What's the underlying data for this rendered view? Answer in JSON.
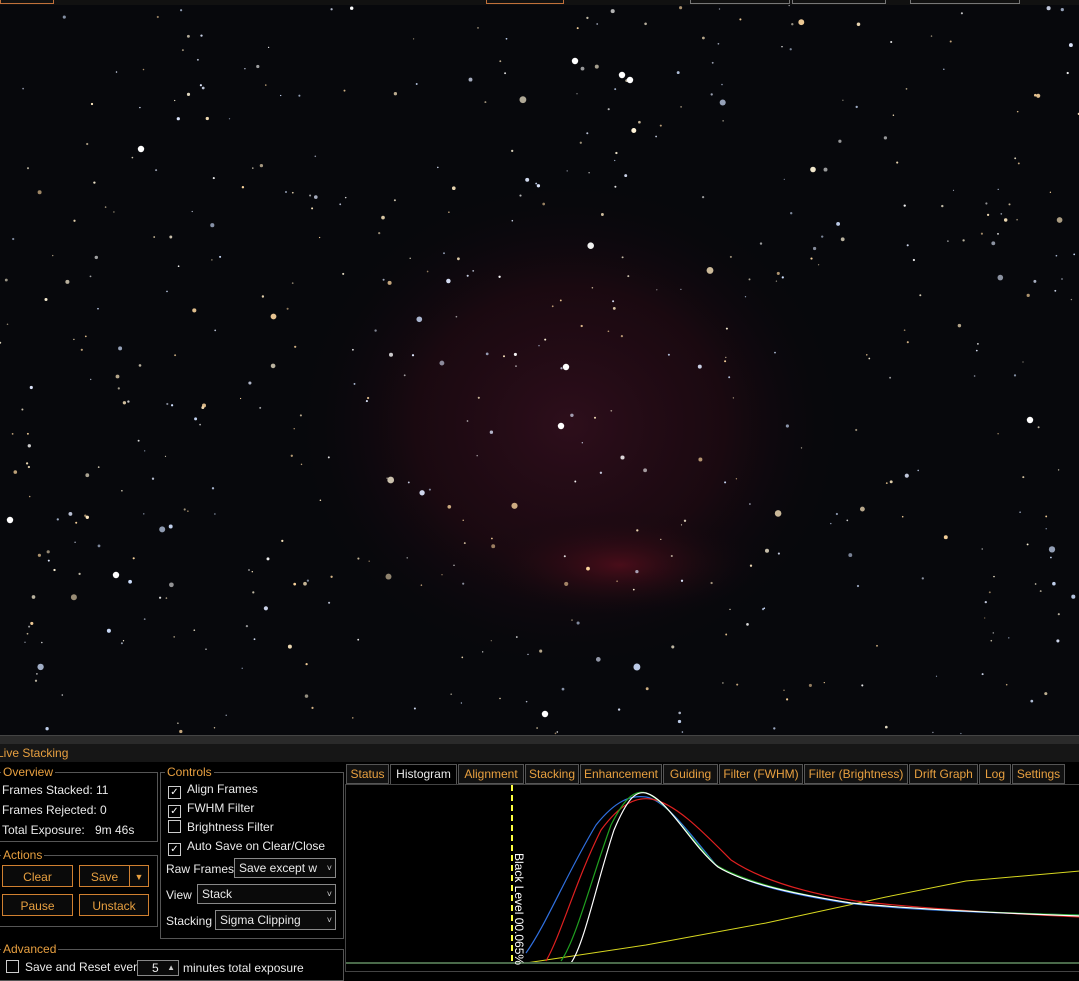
{
  "panel": {
    "title": "Live Stacking"
  },
  "overview": {
    "label": "Overview",
    "frames_stacked_label": "Frames Stacked:",
    "frames_stacked": "11",
    "frames_rejected_label": "Frames Rejected:",
    "frames_rejected": "0",
    "total_exposure_label": "Total Exposure:",
    "total_exposure": "9m 46s"
  },
  "actions": {
    "label": "Actions",
    "clear": "Clear",
    "save": "Save",
    "save_dropdown_icon": "chevron-down-icon",
    "pause": "Pause",
    "unstack": "Unstack"
  },
  "controls": {
    "label": "Controls",
    "align_frames": {
      "label": "Align Frames",
      "checked": true
    },
    "fwhm_filter": {
      "label": "FWHM Filter",
      "checked": true
    },
    "brightness_filter": {
      "label": "Brightness Filter",
      "checked": false
    },
    "auto_save": {
      "label": "Auto Save on Clear/Close",
      "checked": true
    },
    "raw_frames_label": "Raw Frames",
    "raw_frames_value": "Save except w",
    "view_label": "View",
    "view_value": "Stack",
    "stacking_label": "Stacking",
    "stacking_value": "Sigma Clipping"
  },
  "advanced": {
    "label": "Advanced",
    "save_reset_label": "Save and Reset every",
    "minutes_value": "5",
    "minutes_suffix": "minutes total exposure"
  },
  "tabs": [
    "Status",
    "Histogram",
    "Alignment",
    "Stacking",
    "Enhancement",
    "Guiding",
    "Filter (FWHM)",
    "Filter (Brightness)",
    "Drift Graph",
    "Log",
    "Settings"
  ],
  "active_tab": "Histogram",
  "histogram": {
    "black_level_label": "Black Level 00.065%",
    "colors": {
      "red": "#e02020",
      "green": "#20a020",
      "blue": "#3070e0",
      "lum": "#ffffff",
      "curve": "#d8d820",
      "marker": "#ffff40"
    }
  },
  "colors": {
    "accent": "#e8a040",
    "border": "#d08030"
  }
}
